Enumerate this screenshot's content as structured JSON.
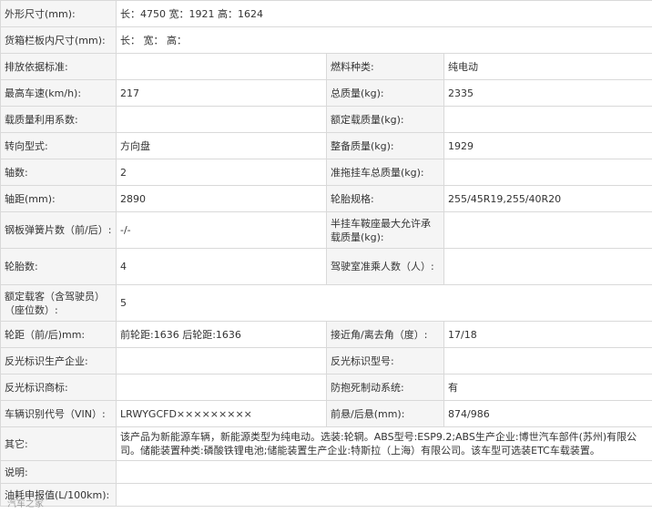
{
  "rows": [
    {
      "label": "外形尺寸(mm):",
      "value": "长：4750 宽：1921 高：1624"
    },
    {
      "label": "货箱栏板内尺寸(mm):",
      "value": "长： 宽： 高："
    },
    {
      "label": "排放依据标准:",
      "value": "",
      "label2": "燃料种类:",
      "value2": "纯电动"
    },
    {
      "label": "最高车速(km/h):",
      "value": "217",
      "label2": "总质量(kg):",
      "value2": "2335"
    },
    {
      "label": "载质量利用系数:",
      "value": "",
      "label2": "额定载质量(kg):",
      "value2": ""
    },
    {
      "label": "转向型式:",
      "value": "方向盘",
      "label2": "整备质量(kg):",
      "value2": "1929"
    },
    {
      "label": "轴数:",
      "value": "2",
      "label2": "准拖挂车总质量(kg):",
      "value2": ""
    },
    {
      "label": "轴距(mm):",
      "value": "2890",
      "label2": "轮胎规格:",
      "value2": "255/45R19,255/40R20"
    },
    {
      "label": "钢板弹簧片数（前/后）:",
      "value": "-/-",
      "label2": "半挂车鞍座最大允许承载质量(kg):",
      "value2": ""
    },
    {
      "label": "轮胎数:",
      "value": "4",
      "label2": "驾驶室准乘人数（人）:",
      "value2": ""
    },
    {
      "label": "额定载客（含驾驶员）（座位数）:",
      "value": "5"
    },
    {
      "label": "轮距（前/后)mm:",
      "value": "前轮距:1636 后轮距:1636",
      "label2": "接近角/离去角（度）:",
      "value2": "17/18"
    },
    {
      "label": "反光标识生产企业:",
      "value": "",
      "label2": "反光标识型号:",
      "value2": ""
    },
    {
      "label": "反光标识商标:",
      "value": "",
      "label2": "防抱死制动系统:",
      "value2": "有"
    },
    {
      "label": "车辆识别代号（VIN）:",
      "value": "LRWYGCFD×××××××××",
      "label2": "前悬/后悬(mm):",
      "value2": "874/986"
    },
    {
      "label": "其它:",
      "value": "该产品为新能源车辆，新能源类型为纯电动。选装:轮辋。ABS型号:ESP9.2;ABS生产企业:博世汽车部件(苏州)有限公司。储能装置种类:磷酸铁锂电池;储能装置生产企业:特斯拉（上海）有限公司。该车型可选装ETC车载装置。"
    },
    {
      "label": "说明:",
      "value": ""
    },
    {
      "label": "油耗申报值(L/100km):",
      "value": ""
    }
  ],
  "watermark": "汽车之家"
}
